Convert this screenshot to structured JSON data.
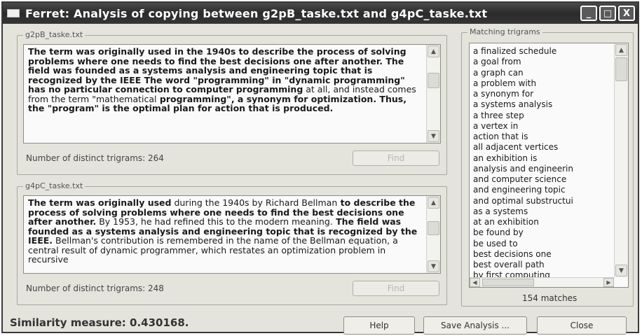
{
  "window": {
    "title": "Ferret: Analysis of copying between g2pB_taske.txt and g4pC_taske.txt",
    "controls": {
      "minimize": "_",
      "maximize": "□",
      "close": "X"
    }
  },
  "doc1": {
    "title": "g2pB_taske.txt",
    "segments": [
      {
        "t": "The term was originally used",
        "b": true
      },
      {
        "t": " in the 1940s to describe the process of solving problems where one needs to find the best decisions one after another.",
        "b": true
      },
      {
        "t": " The field was founded as a systems analysis and engineering topic that is recognized by the IEEE",
        "b": true
      },
      {
        "t": " The word \"programming\" in \"dynamic programming\" has no particular connection to computer programming",
        "b": true
      },
      {
        "t": " at all, and instead comes from the term \"mathematical",
        "b": false
      },
      {
        "t": " programming\", a synonym for optimization.",
        "b": true
      },
      {
        "t": " Thus, the \"program\" is the optimal plan for action that is produced.",
        "b": true
      }
    ],
    "trigram_label": "Number of distinct trigrams: 264",
    "find_label": "Find"
  },
  "doc2": {
    "title": "g4pC_taske.txt",
    "segments": [
      {
        "t": "The term was originally used",
        "b": true
      },
      {
        "t": " during the 1940s by Richard Bellman",
        "b": false
      },
      {
        "t": " to describe the process of solving problems where one needs to find the best decisions one after another.",
        "b": true
      },
      {
        "t": " By 1953, he had refined this to the modern meaning.",
        "b": false
      },
      {
        "t": " The field was founded as a systems analysis and engineering topic that is recognized by the IEEE.",
        "b": true
      },
      {
        "t": " Bellman's contribution is remembered in the name of the Bellman equation, a central result of dynamic programmer, which restates an optimization problem in recursive",
        "b": false
      }
    ],
    "trigram_label": "Number of distinct trigrams: 248",
    "find_label": "Find"
  },
  "trigrams": {
    "title": "Matching trigrams",
    "items": [
      "a finalized schedule",
      "a goal from",
      "a graph can",
      "a problem with",
      "a synonym for",
      "a systems analysis",
      "a three step",
      "a vertex in",
      "action that is",
      "all adjacent vertices",
      "an exhibition is",
      "analysis and engineerin",
      "and computer science",
      "and engineering topic",
      "and optimal substructui",
      "as a systems",
      "at an exhibition",
      "be found by",
      "be used to",
      "best decisions one",
      "best overall path",
      "by first computing"
    ],
    "matches_label": "154 matches"
  },
  "footer": {
    "similarity": "Similarity measure: 0.430168.",
    "help": "Help",
    "save": "Save Analysis ...",
    "close": "Close"
  }
}
